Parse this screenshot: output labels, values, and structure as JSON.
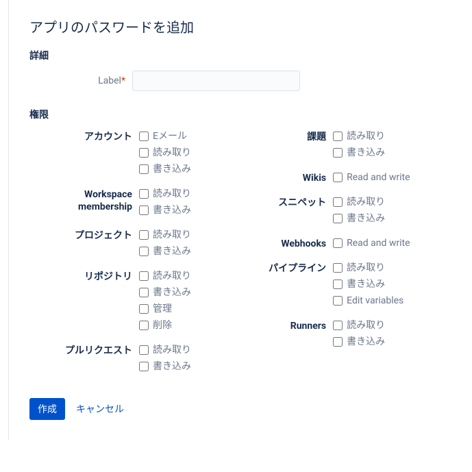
{
  "title": "アプリのパスワードを追加",
  "sections": {
    "details": "詳細",
    "permissions": "権限"
  },
  "label_field": {
    "label": "Label",
    "required_mark": "*",
    "value": ""
  },
  "perm_left": [
    {
      "name": "アカウント",
      "opts": [
        "Eメール",
        "読み取り",
        "書き込み"
      ]
    },
    {
      "name": "Workspace membership",
      "opts": [
        "読み取り",
        "書き込み"
      ]
    },
    {
      "name": "プロジェクト",
      "opts": [
        "読み取り",
        "書き込み"
      ]
    },
    {
      "name": "リポジトリ",
      "opts": [
        "読み取り",
        "書き込み",
        "管理",
        "削除"
      ]
    },
    {
      "name": "プルリクエスト",
      "opts": [
        "読み取り",
        "書き込み"
      ]
    }
  ],
  "perm_right": [
    {
      "name": "課題",
      "opts": [
        "読み取り",
        "書き込み"
      ]
    },
    {
      "name": "Wikis",
      "opts": [
        "Read and write"
      ]
    },
    {
      "name": "スニペット",
      "opts": [
        "読み取り",
        "書き込み"
      ]
    },
    {
      "name": "Webhooks",
      "opts": [
        "Read and write"
      ]
    },
    {
      "name": "パイプライン",
      "opts": [
        "読み取り",
        "書き込み",
        "Edit variables"
      ]
    },
    {
      "name": "Runners",
      "opts": [
        "読み取り",
        "書き込み"
      ]
    }
  ],
  "actions": {
    "create": "作成",
    "cancel": "キャンセル"
  }
}
